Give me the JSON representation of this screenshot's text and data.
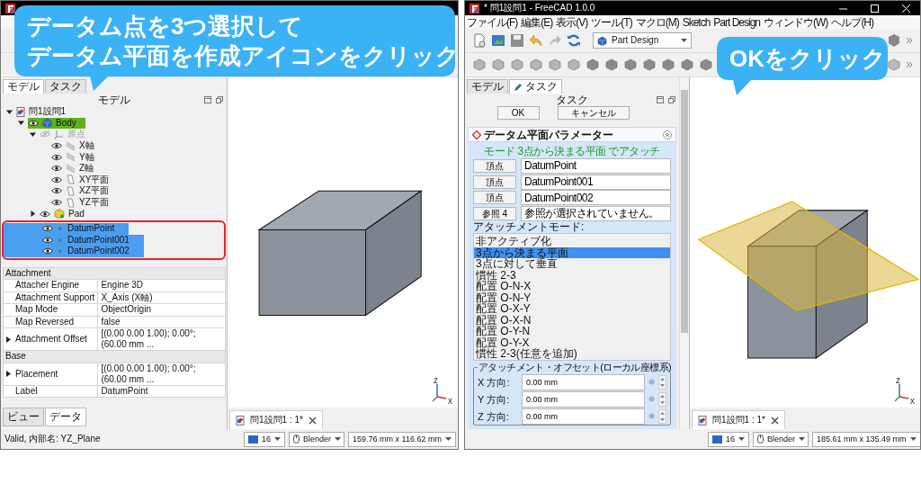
{
  "left_window": {
    "callout": {
      "lines": [
        "データム点を3つ選択して",
        "データム平面を作成アイコンをクリック"
      ]
    },
    "tabs": [
      {
        "label": "モデル",
        "selected": true
      },
      {
        "label": "タスク",
        "selected": false
      }
    ],
    "panel_title": "モデル",
    "tree": [
      {
        "label": "問1設問1",
        "kind": "document",
        "expanded": true,
        "selected": false,
        "children": [
          {
            "label": "Body",
            "kind": "body",
            "expanded": true,
            "active": true,
            "visible": true,
            "selected": false,
            "children": [
              {
                "label": "原点",
                "kind": "origin",
                "expanded": true,
                "visible": false,
                "selected": false,
                "children": [
                  {
                    "label": "X軸",
                    "kind": "axis",
                    "visible": true,
                    "selected": false
                  },
                  {
                    "label": "Y軸",
                    "kind": "axis",
                    "visible": true,
                    "selected": false
                  },
                  {
                    "label": "Z軸",
                    "kind": "axis",
                    "visible": true,
                    "selected": false
                  },
                  {
                    "label": "XY平面",
                    "kind": "plane",
                    "visible": true,
                    "selected": false
                  },
                  {
                    "label": "XZ平面",
                    "kind": "plane",
                    "visible": true,
                    "selected": false
                  },
                  {
                    "label": "YZ平面",
                    "kind": "plane",
                    "visible": true,
                    "selected": false
                  }
                ]
              },
              {
                "label": "Pad",
                "kind": "pad",
                "expanded": false,
                "visible": true,
                "selected": false
              },
              {
                "label": "DatumPoint",
                "kind": "point",
                "visible": true,
                "selected": true
              },
              {
                "label": "DatumPoint001",
                "kind": "point",
                "visible": true,
                "selected": true
              },
              {
                "label": "DatumPoint002",
                "kind": "point",
                "visible": true,
                "selected": true
              }
            ]
          }
        ]
      }
    ],
    "properties": [
      {
        "group": "Attachment",
        "rows": [
          {
            "property": "Attacher Engine",
            "value": "Engine 3D",
            "expandable": false
          },
          {
            "property": "Attachment Support",
            "value": "X_Axis (X軸)",
            "expandable": false
          },
          {
            "property": "Map Mode",
            "value": "ObjectOrigin",
            "expandable": false
          },
          {
            "property": "Map Reversed",
            "value": "false",
            "expandable": false
          },
          {
            "property": "Attachment Offset",
            "value": "[(0.00 0.00 1.00); 0.00°; (60.00 mm ...",
            "expandable": true
          }
        ]
      },
      {
        "group": "Base",
        "rows": [
          {
            "property": "Placement",
            "value": "[(0.00 0.00 1.00); 0.00°; (60.00 mm ...",
            "expandable": true
          },
          {
            "property": "Label",
            "value": "DatumPoint",
            "expandable": false
          }
        ]
      }
    ],
    "bottom_tabs": [
      {
        "label": "ビュー",
        "selected": false
      },
      {
        "label": "データ",
        "selected": true
      }
    ],
    "status_text": "Valid, 内部名: YZ_Plane",
    "document_tab": "問1設問1 : 1*",
    "status_bar": {
      "draw_style": "16",
      "navigation": "Blender",
      "dimensions": "159.76 mm x 116.62 mm"
    },
    "axis_labels": [
      "z",
      "x"
    ]
  },
  "right_window": {
    "title": "* 問1設問1 - FreeCAD 1.0.0",
    "menu": [
      "ファイル(F)",
      "編集(E)",
      "表示(V)",
      "ツール(T)",
      "マクロ(M)",
      "Sketch",
      "Part Design",
      "ウィンドウ(W)",
      "ヘルプ(H)"
    ],
    "workbench": "Part Design",
    "callout": {
      "lines": [
        "OKをクリック"
      ]
    },
    "tabs": [
      {
        "label": "モデル",
        "selected": false
      },
      {
        "label": "タスク",
        "selected": true
      }
    ],
    "panel_title": "タスク",
    "buttons": [
      "OK",
      "キャンセル"
    ],
    "section_title": "データム平面パラメーター",
    "mode_text": "モード 3点から決まる平面 でアタッチ",
    "references": [
      {
        "button": "頂点",
        "value": "DatumPoint"
      },
      {
        "button": "頂点",
        "value": "DatumPoint001"
      },
      {
        "button": "頂点",
        "value": "DatumPoint002"
      },
      {
        "button": "参照 4",
        "value": "参照が選択されていません。"
      }
    ],
    "mode_label": "アタッチメントモード:",
    "modes": [
      {
        "label": "非アクティブ化",
        "selected": false
      },
      {
        "label": "3点から決まる平面",
        "selected": true
      },
      {
        "label": "3点に対して垂直",
        "selected": false
      },
      {
        "label": "慣性 2-3",
        "selected": false
      },
      {
        "label": "配置 O-N-X",
        "selected": false
      },
      {
        "label": "配置 O-N-Y",
        "selected": false
      },
      {
        "label": "配置 O-X-Y",
        "selected": false
      },
      {
        "label": "配置 O-X-N",
        "selected": false
      },
      {
        "label": "配置 O-Y-N",
        "selected": false
      },
      {
        "label": "配置 O-Y-X",
        "selected": false
      },
      {
        "label": "慣性 2-3(任意を追加)",
        "selected": false
      }
    ],
    "offset": {
      "title": "アタッチメント・オフセット(ローカル座標系)",
      "fields": [
        {
          "label": "X 方向:",
          "value": "0.00 mm"
        },
        {
          "label": "Y 方向:",
          "value": "0.00 mm"
        },
        {
          "label": "Z 方向:",
          "value": "0.00 mm"
        }
      ]
    },
    "document_tab": "問1設問1 : 1*",
    "status_bar": {
      "draw_style": "16",
      "navigation": "Blender",
      "dimensions": "185.61 mm x 135.49 mm"
    },
    "axis_labels": [
      "z",
      "x"
    ]
  }
}
